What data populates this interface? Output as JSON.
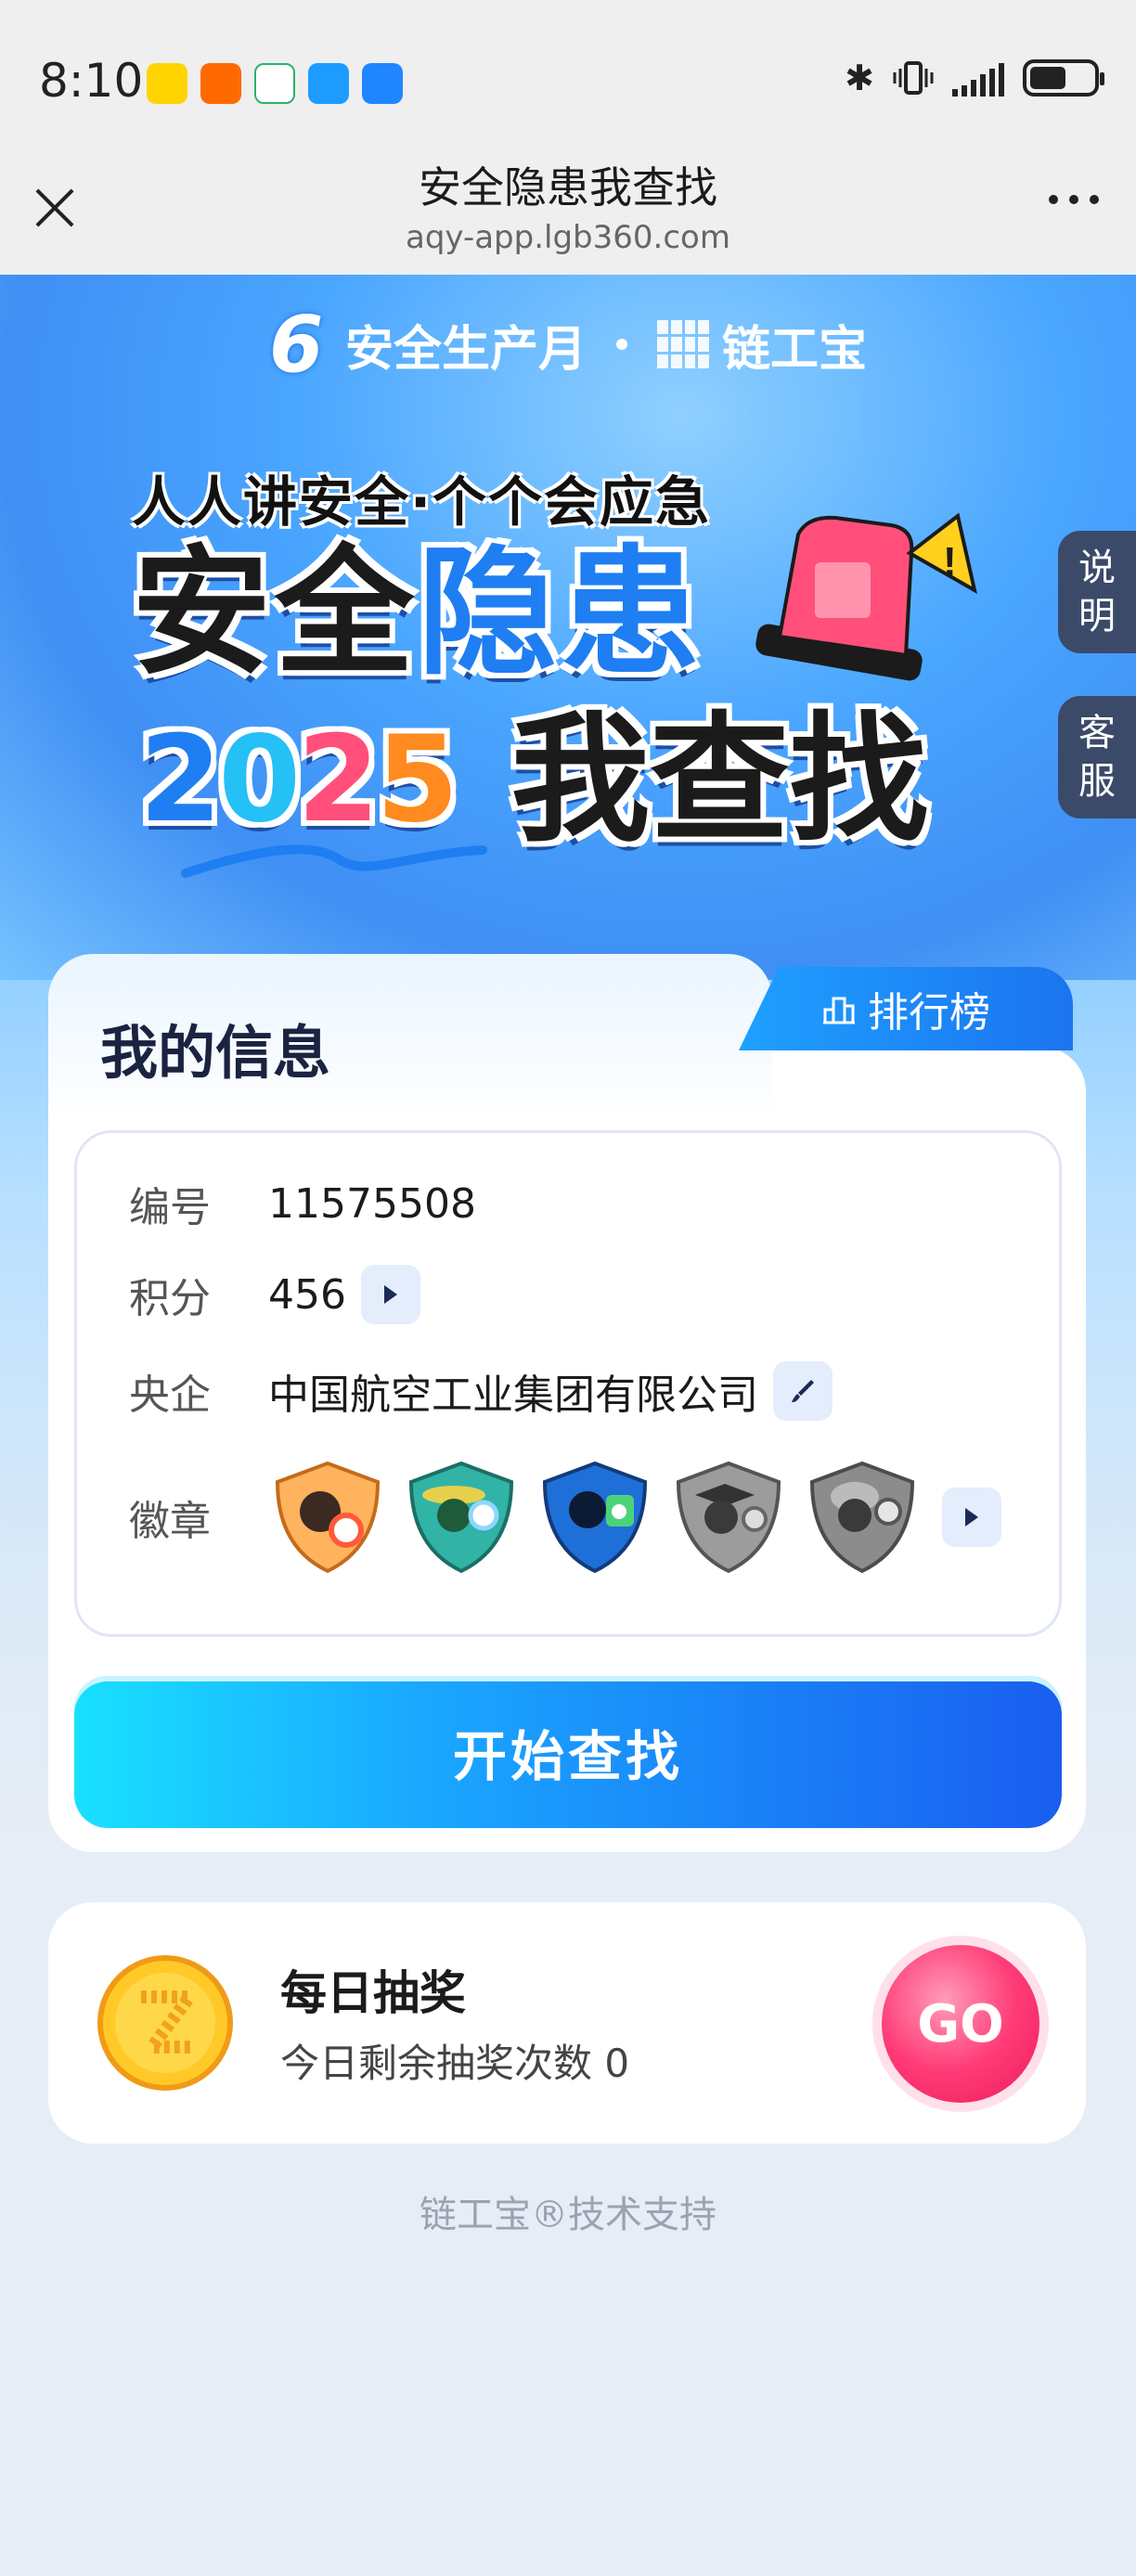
{
  "status_bar": {
    "time": "8:10",
    "apps": [
      "meituan-icon",
      "taobao-icon",
      "mobile-icon",
      "search-app-icon",
      "weather-icon"
    ]
  },
  "browser": {
    "title": "安全隐患我查找",
    "url": "aqy-app.lgb360.com"
  },
  "hero": {
    "brand_left": "安全生产月",
    "brand_right": "链工宝",
    "slogan": "人人讲安全·个个会应急",
    "title_part1": "安全",
    "title_part2": "隐患",
    "year_digits": [
      "2",
      "0",
      "2",
      "5"
    ],
    "title_part3": "我查找"
  },
  "side_tabs": [
    {
      "chars": [
        "说",
        "明"
      ]
    },
    {
      "chars": [
        "客",
        "服"
      ]
    }
  ],
  "info_card": {
    "title": "我的信息",
    "rank_label": "排行榜",
    "rows": {
      "id_label": "编号",
      "id_value": "11575508",
      "points_label": "积分",
      "points_value": "456",
      "org_label": "央企",
      "org_value": "中国航空工业集团有限公司",
      "badge_label": "徽章"
    },
    "start_button": "开始查找"
  },
  "lottery": {
    "title": "每日抽奖",
    "subtitle": "今日剩余抽奖次数 0",
    "go_label": "GO"
  },
  "footer": "链工宝®技术支持"
}
